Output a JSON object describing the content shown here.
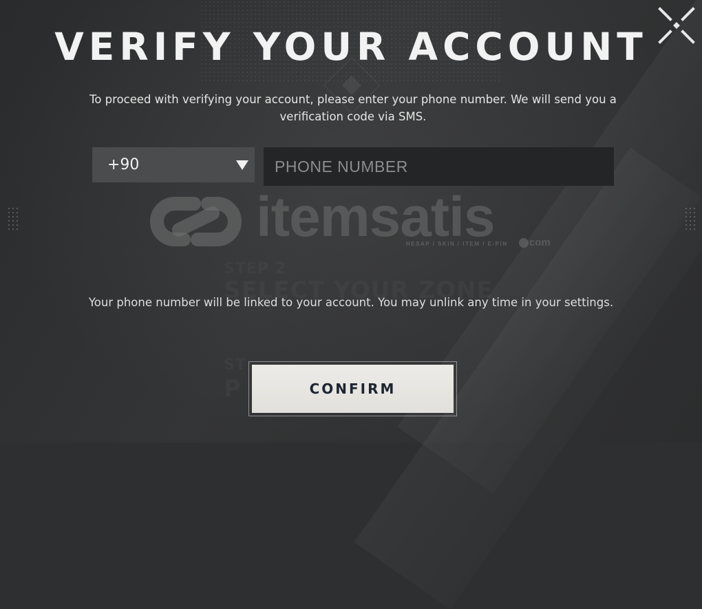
{
  "dialog": {
    "title": "VERIFY YOUR ACCOUNT",
    "intro_text": "To proceed with verifying your account, please enter your phone number. We will send you a verification code via SMS.",
    "close_icon": "close-x-icon"
  },
  "phone_form": {
    "country_code": "+90",
    "country_dropdown_icon": "caret-down-icon",
    "phone_placeholder": "PHONE NUMBER",
    "phone_value": ""
  },
  "background": {
    "ghost_step2": "STEP 2",
    "ghost_step2_title": "SELECT YOUR ZONE",
    "ghost_step3": "ST",
    "ghost_step3_title": "P                     S"
  },
  "watermark": {
    "brand": "itemsatis",
    "tagline": "HESAP / SKIN / ITEM / E-PIN",
    "domain": "com"
  },
  "footer_note": "Your phone number will be linked to your account. You may unlink any time in your settings.",
  "actions": {
    "confirm_label": "CONFIRM"
  },
  "colors": {
    "background": "#2e2f30",
    "select_bg": "#4b4c4d",
    "input_bg": "#242526",
    "button_bg": "#e8e6e2",
    "button_text": "#1d2530",
    "text": "#f2f2f2"
  }
}
